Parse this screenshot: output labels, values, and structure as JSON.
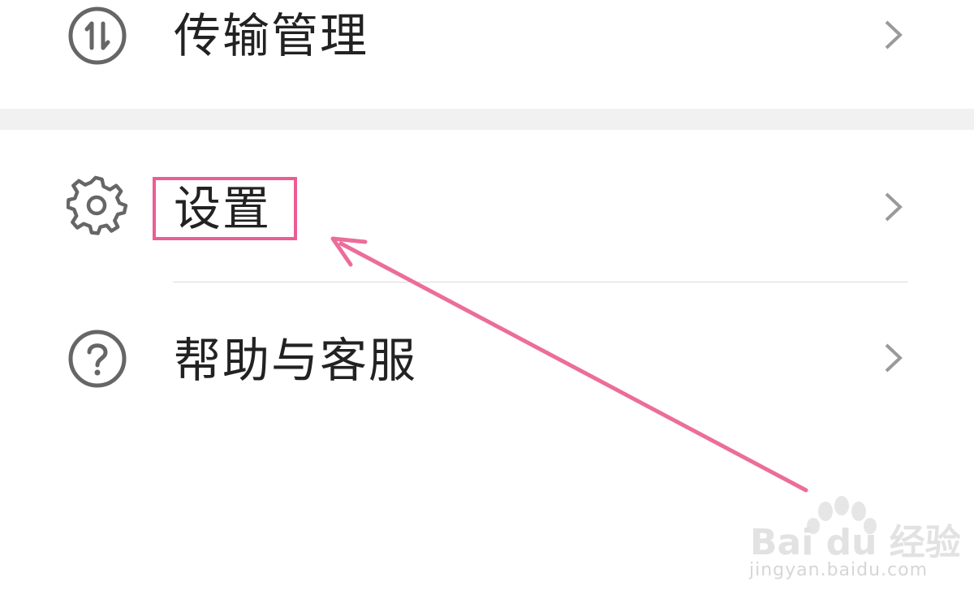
{
  "menu": {
    "items": [
      {
        "label": "传输管理",
        "icon": "transfer-icon"
      },
      {
        "label": "设置",
        "icon": "gear-icon"
      },
      {
        "label": "帮助与客服",
        "icon": "help-icon"
      }
    ]
  },
  "annotation": {
    "highlight_color": "#ec5d95",
    "arrow_color": "#ec6d9a"
  },
  "watermark": {
    "brand": "Bai du 经验",
    "url": "jingyan.baidu.com"
  }
}
